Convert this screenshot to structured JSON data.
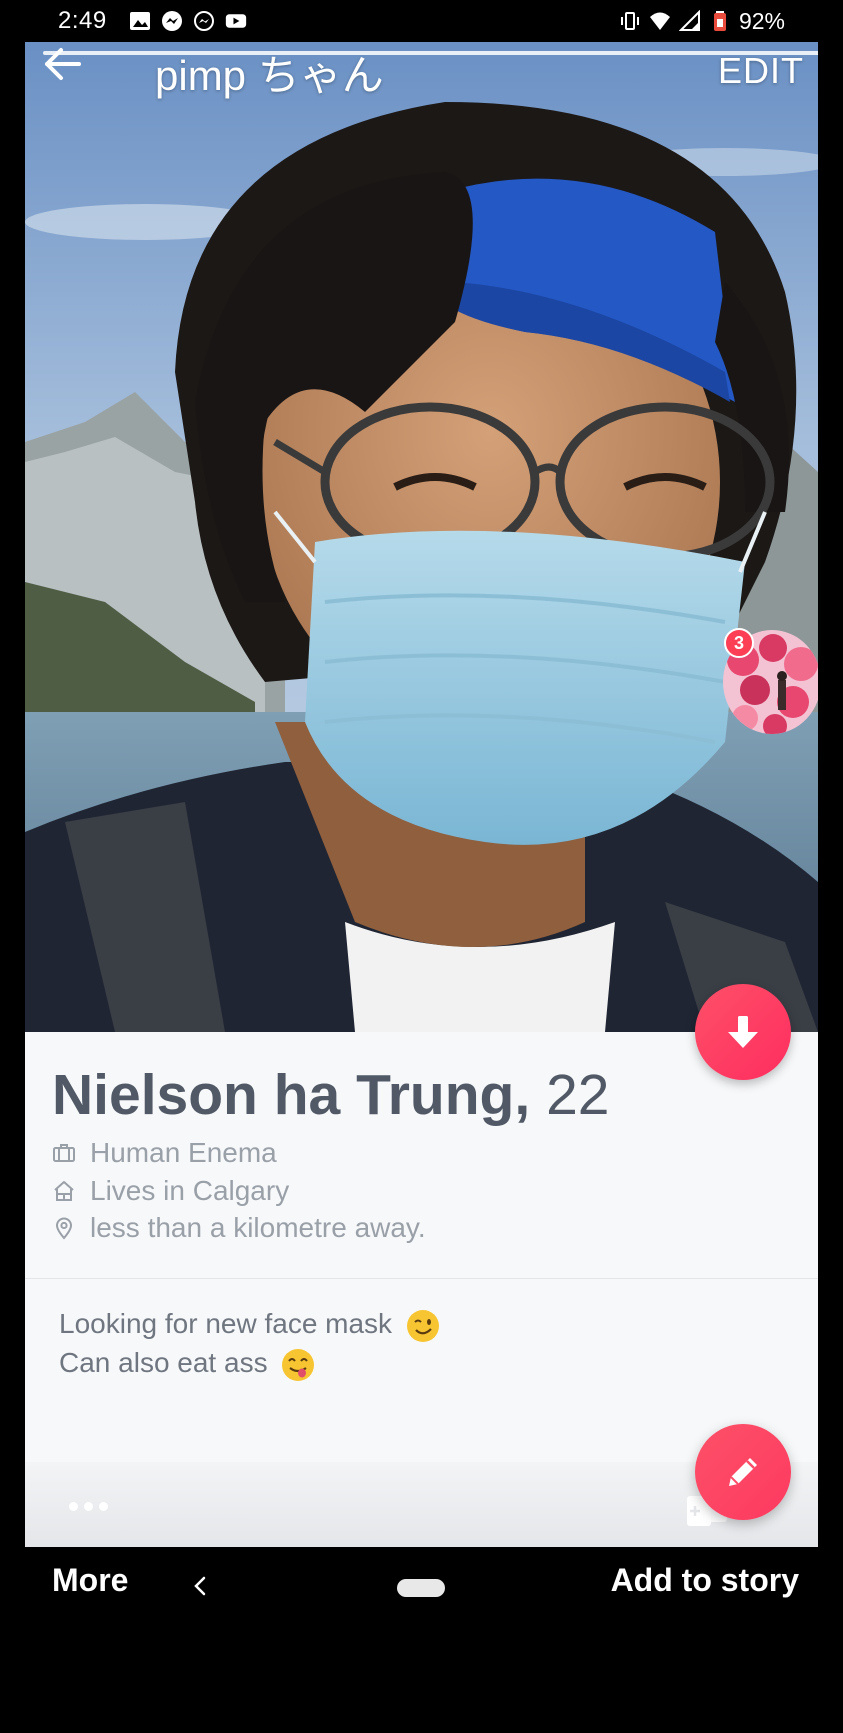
{
  "status_bar": {
    "time": "2:49",
    "battery": "92%",
    "left_icons": [
      "gallery-icon",
      "messenger-icon",
      "messenger-outline-icon",
      "youtube-icon"
    ],
    "right_icons": [
      "vibrate-icon",
      "wifi-icon",
      "signal-icon",
      "battery-icon"
    ]
  },
  "story_header": {
    "back_icon": "arrow-left-icon",
    "title": "pimp ちゃん",
    "edit_label": "EDIT"
  },
  "story_bubble": {
    "count": "3"
  },
  "profile": {
    "name": "Nielson ha Trung,",
    "age": "22",
    "job": "Human Enema",
    "residence": "Lives in Calgary",
    "distance": "less than a kilometre away.",
    "bio_line_1": "Looking for new face mask",
    "bio_line_2": "Can also eat ass"
  },
  "bottom_bar": {
    "more_label": "More",
    "add_story_label": "Add to story"
  },
  "colors": {
    "accent": "#fd4e6a",
    "name_text": "#505965",
    "detail_text": "#9aa0a8",
    "card_bg": "#f7f8fa"
  }
}
